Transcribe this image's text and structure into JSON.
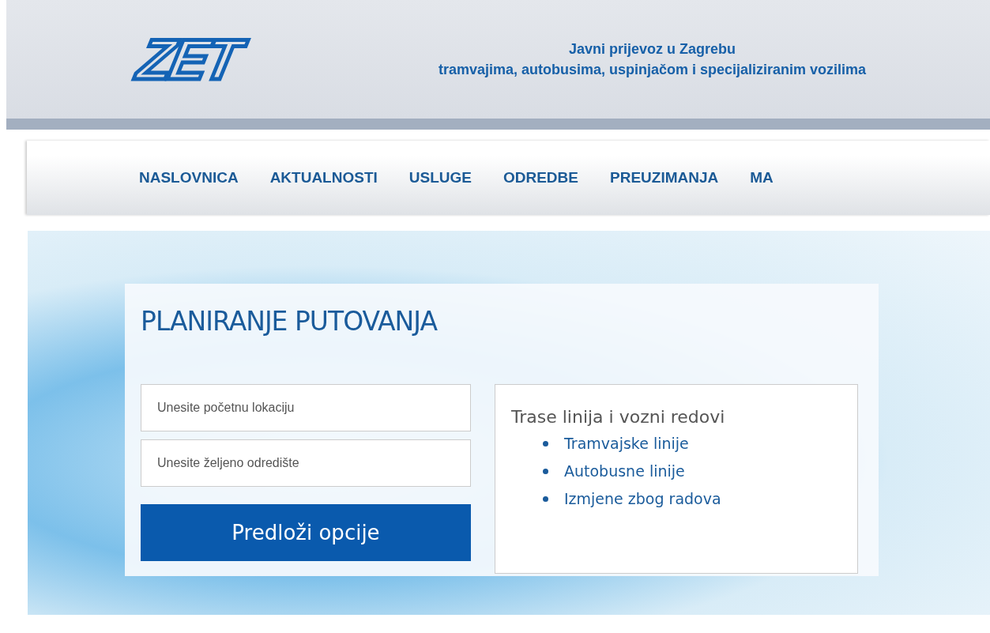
{
  "header": {
    "logo": "ZET",
    "title": "Javni prijevoz u Zagrebu",
    "subtitle": "tramvajima, autobusima, uspinjačom i specijaliziranim vozilima"
  },
  "nav": [
    {
      "label": "NASLOVNICA"
    },
    {
      "label": "AKTUALNOSTI"
    },
    {
      "label": "USLUGE"
    },
    {
      "label": "ODREDBE"
    },
    {
      "label": "PREUZIMANJA"
    },
    {
      "label": "MA"
    }
  ],
  "planner": {
    "title": "PLANIRANJE PUTOVANJA",
    "fields": [
      {
        "placeholder": "Unesite početnu lokaciju"
      },
      {
        "placeholder": "Unesite željeno odredište"
      }
    ],
    "button": "Predloži opcije"
  },
  "routes": {
    "title": "Trase linija i vozni redovi",
    "links": [
      {
        "label": "Tramvajske linije"
      },
      {
        "label": "Autobusne linije"
      },
      {
        "label": "Izmjene zbog radova"
      }
    ]
  }
}
